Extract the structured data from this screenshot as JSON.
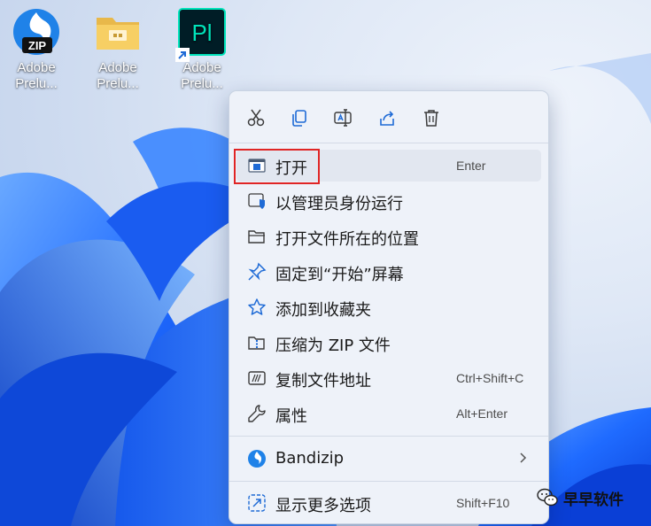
{
  "desktop": {
    "icons": [
      {
        "label": "Adobe\nPrelu...",
        "line1": "Adobe",
        "line2": "Prelu...",
        "icon": "bandizip-zip-icon",
        "badge": "ZIP"
      },
      {
        "label": "Adobe\nPrelu...",
        "line1": "Adobe",
        "line2": "Prelu...",
        "icon": "folder-icon"
      },
      {
        "label": "Adobe\nPrelu...",
        "line1": "Adobe",
        "line2": "Prelu...",
        "icon": "adobe-prelude-icon",
        "badge": "Pl",
        "shortcut": true
      }
    ]
  },
  "context_menu": {
    "toolbar": [
      "cut-icon",
      "copy-icon",
      "rename-icon",
      "share-icon",
      "delete-icon"
    ],
    "items": [
      {
        "label": "打开",
        "shortcut": "Enter",
        "icon": "open-window-icon",
        "highlighted": true
      },
      {
        "label": "以管理员身份运行",
        "shortcut": "",
        "icon": "admin-shield-icon"
      },
      {
        "label": "打开文件所在的位置",
        "shortcut": "",
        "icon": "folder-open-icon"
      },
      {
        "label": "固定到“开始”屏幕",
        "shortcut": "",
        "icon": "pin-icon"
      },
      {
        "label": "添加到收藏夹",
        "shortcut": "",
        "icon": "star-icon"
      },
      {
        "label": "压缩为 ZIP 文件",
        "shortcut": "",
        "icon": "zip-folder-icon"
      },
      {
        "label": "复制文件地址",
        "shortcut": "Ctrl+Shift+C",
        "icon": "copy-path-icon"
      },
      {
        "label": "属性",
        "shortcut": "Alt+Enter",
        "icon": "wrench-icon"
      }
    ],
    "bandizip": {
      "label": "Bandizip",
      "icon": "bandizip-icon",
      "submenu": true
    },
    "more": {
      "label": "显示更多选项",
      "shortcut": "Shift+F10",
      "icon": "more-options-icon"
    }
  },
  "watermark": {
    "text": "早早软件"
  },
  "colors": {
    "accent": "#0067c0",
    "highlight_box": "#e02525",
    "menu_bg": "#eef2f9"
  }
}
